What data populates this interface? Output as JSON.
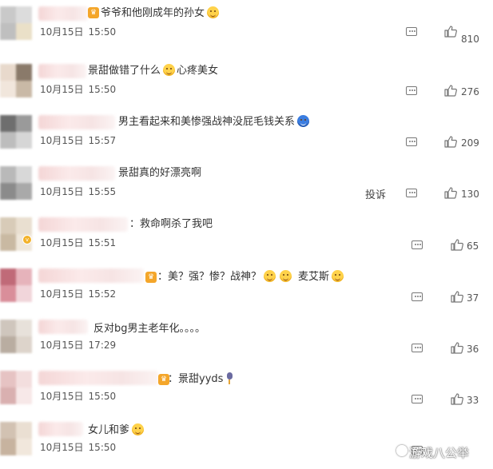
{
  "comments": [
    {
      "text": "爷爷和他刚成年的孙女",
      "date": "10月15日",
      "time": "15:50",
      "likes": "810",
      "emoji": "grin-emoji",
      "colors": [
        "#c9c9c9",
        "#dcdcdc",
        "#bfbfbf",
        "#eae0c8"
      ]
    },
    {
      "text_a": "景甜做错了什么",
      "text_b": "心疼美女",
      "date": "10月15日",
      "time": "15:50",
      "likes": "276",
      "emoji": "crying-emoji",
      "colors": [
        "#e8d9cc",
        "#8a7a6a",
        "#f1e6dc",
        "#c9b9a6"
      ]
    },
    {
      "text": "男主看起来和美惨强战神没屁毛钱关系",
      "date": "10月15日",
      "time": "15:57",
      "likes": "209",
      "emoji": "blue-emoji",
      "colors": [
        "#6e6e6e",
        "#9a9a9a",
        "#bdbdbd",
        "#d6d6d6"
      ]
    },
    {
      "text": "景甜真的好漂亮啊",
      "date": "10月15日",
      "time": "15:55",
      "likes": "130",
      "report": "投诉",
      "colors": [
        "#b9b9b9",
        "#d8d8d8",
        "#8b8b8b",
        "#a9a9a9"
      ]
    },
    {
      "text": "救命啊杀了我吧",
      "date": "10月15日",
      "time": "15:51",
      "likes": "65",
      "colors": [
        "#d8cbb8",
        "#e9dfd0",
        "#c9b9a2",
        "#efe7db"
      ]
    },
    {
      "text": "美？强？惨？战神？",
      "text_b": "麦艾斯",
      "date": "10月15日",
      "time": "15:52",
      "likes": "37",
      "colors": [
        "#c06a78",
        "#e6b3bb",
        "#d98e9a",
        "#f1d5da"
      ]
    },
    {
      "text": "反对bg男主老年化。。。。",
      "date": "10月15日",
      "time": "17:29",
      "likes": "36",
      "colors": [
        "#cfc6bd",
        "#e7e1da",
        "#b9ada1",
        "#ddd4cb"
      ]
    },
    {
      "text": "景甜yyds",
      "date": "10月15日",
      "time": "15:50",
      "likes": "33",
      "emoji": "microphone-emoji",
      "colors": [
        "#e6c3c3",
        "#f3dede",
        "#d9b0b0",
        "#f7e8e8"
      ]
    },
    {
      "text": "女儿和爹",
      "date": "10月15日",
      "time": "15:50",
      "colors": [
        "#d2c2b2",
        "#eadfd2",
        "#c7b39f",
        "#f1e7dc"
      ]
    }
  ],
  "watermark": "游戏八公举"
}
